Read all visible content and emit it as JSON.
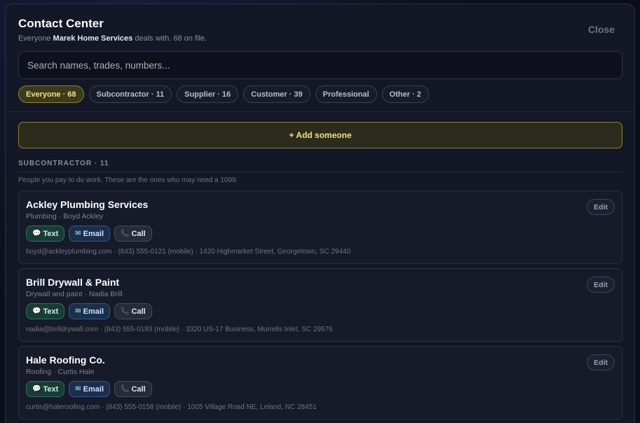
{
  "modal": {
    "title": "Contact Center",
    "subtitle_prefix": "Everyone",
    "company": "Marek Home Services",
    "subtitle_suffix": "deals with. 68 on file.",
    "close_label": "Close"
  },
  "search": {
    "placeholder": "Search names, trades, numbers..."
  },
  "filters": [
    {
      "label": "Everyone · 68",
      "active": true
    },
    {
      "label": "Subcontractor · 11",
      "active": false
    },
    {
      "label": "Supplier · 16",
      "active": false
    },
    {
      "label": "Customer · 39",
      "active": false
    },
    {
      "label": "Professional",
      "active": false
    },
    {
      "label": "Other · 2",
      "active": false
    }
  ],
  "add_label": "+ Add someone",
  "section": {
    "title": "SUBCONTRACTOR · 11",
    "description": "People you pay to do work. These are the ones who may need a 1099."
  },
  "action_labels": {
    "text": "Text",
    "email": "Email",
    "call": "Call",
    "edit": "Edit"
  },
  "icons": {
    "text": "speech-bubble-icon",
    "email": "envelope-icon",
    "call": "phone-icon"
  },
  "contacts": [
    {
      "name": "Ackley Plumbing Services",
      "sub": "Plumbing · Boyd Ackley",
      "info": "boyd@ackleyplumbing.com · (843) 555-0121 (mobile) · 1420 Highmarket Street, Georgetown, SC 29440"
    },
    {
      "name": "Brill Drywall & Paint",
      "sub": "Drywall and paint · Nadia Brill",
      "info": "nadia@brilldrywall.com · (843) 555-0193 (mobile) · 3320 US-17 Business, Murrells Inlet, SC 29576"
    },
    {
      "name": "Hale Roofing Co.",
      "sub": "Roofing · Curtis Hale",
      "info": "curtis@haleroofing.com · (843) 555-0158 (mobile) · 1005 Village Road NE, Leland, NC 28451"
    }
  ]
}
